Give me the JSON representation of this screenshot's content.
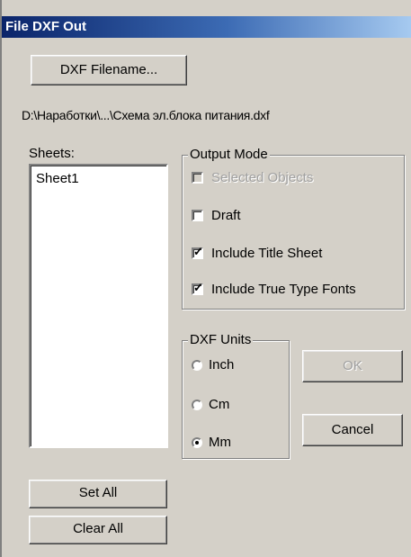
{
  "window": {
    "title": "File DXF Out"
  },
  "file": {
    "button_label": "DXF Filename...",
    "path": "D:\\Наработки\\...\\Схема эл.блока питания.dxf"
  },
  "sheets": {
    "label": "Sheets:",
    "items": [
      "Sheet1"
    ],
    "set_all_label": "Set All",
    "clear_all_label": "Clear All"
  },
  "output_mode": {
    "caption": "Output Mode",
    "options": [
      {
        "label": "Selected Objects",
        "checked": false,
        "enabled": false
      },
      {
        "label": "Draft",
        "checked": false,
        "enabled": true
      },
      {
        "label": "Include Title Sheet",
        "checked": true,
        "enabled": true
      },
      {
        "label": "Include True Type Fonts",
        "checked": true,
        "enabled": true
      }
    ]
  },
  "dxf_units": {
    "caption": "DXF Units",
    "options": [
      {
        "label": "Inch",
        "selected": false
      },
      {
        "label": "Cm",
        "selected": false
      },
      {
        "label": "Mm",
        "selected": true
      }
    ]
  },
  "buttons": {
    "ok_label": "OK",
    "ok_enabled": false,
    "cancel_label": "Cancel"
  }
}
